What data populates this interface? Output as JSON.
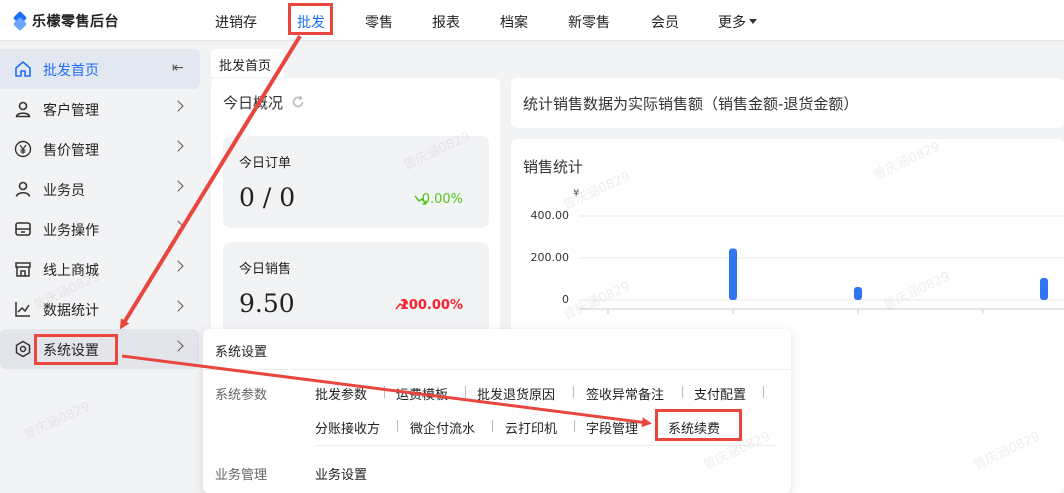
{
  "app": {
    "title": "乐檬零售后台"
  },
  "topnav": {
    "items": [
      {
        "label": "进销存"
      },
      {
        "label": "批发"
      },
      {
        "label": "零售"
      },
      {
        "label": "报表"
      },
      {
        "label": "档案"
      },
      {
        "label": "新零售"
      },
      {
        "label": "会员"
      },
      {
        "label": "更多"
      }
    ],
    "active": "批发"
  },
  "sidebar": {
    "items": [
      {
        "label": "批发首页",
        "icon": "home-icon"
      },
      {
        "label": "客户管理",
        "icon": "user-icon"
      },
      {
        "label": "售价管理",
        "icon": "yuan-icon"
      },
      {
        "label": "业务员",
        "icon": "person-icon"
      },
      {
        "label": "业务操作",
        "icon": "drawer-icon"
      },
      {
        "label": "线上商城",
        "icon": "shop-icon"
      },
      {
        "label": "数据统计",
        "icon": "chart-icon"
      },
      {
        "label": "系统设置",
        "icon": "settings-icon"
      }
    ],
    "collapse_symbol": "⇤"
  },
  "tabs": [
    {
      "label": "批发首页"
    }
  ],
  "overview": {
    "title": "今日概况",
    "cards": [
      {
        "title": "今日订单",
        "value": "0 / 0",
        "change": "0.00%",
        "trend": "down",
        "color": "#52c41a"
      },
      {
        "title": "今日销售",
        "value": "9.50",
        "change": "100.00%",
        "trend": "up",
        "color": "#f5222d"
      }
    ]
  },
  "notice": {
    "text": "统计销售数据为实际销售额（销售金额-退货金额）"
  },
  "sales_chart": {
    "title": "销售统计"
  },
  "chart_data": {
    "type": "bar",
    "title": "销售统计",
    "ylabel": "¥",
    "y_ticks": [
      "400.00",
      "200.00",
      "0"
    ],
    "ylim": [
      0,
      400
    ],
    "series": [
      {
        "values": [
          245,
          62,
          105
        ]
      }
    ],
    "grid": true,
    "color": "#2f74f0"
  },
  "dropdown": {
    "header": "系统设置",
    "groups": [
      {
        "label": "系统参数",
        "links": [
          "批发参数",
          "运费模板",
          "批发退货原因",
          "签收异常备注",
          "支付配置",
          "分账接收方",
          "微企付流水",
          "云打印机",
          "字段管理",
          "系统续费"
        ]
      },
      {
        "label": "业务管理",
        "links": [
          "业务设置"
        ]
      }
    ]
  },
  "watermark": {
    "text": "曾庆涵0829"
  },
  "colors": {
    "accent": "#1e6ff7",
    "annotation": "#e8463e"
  }
}
